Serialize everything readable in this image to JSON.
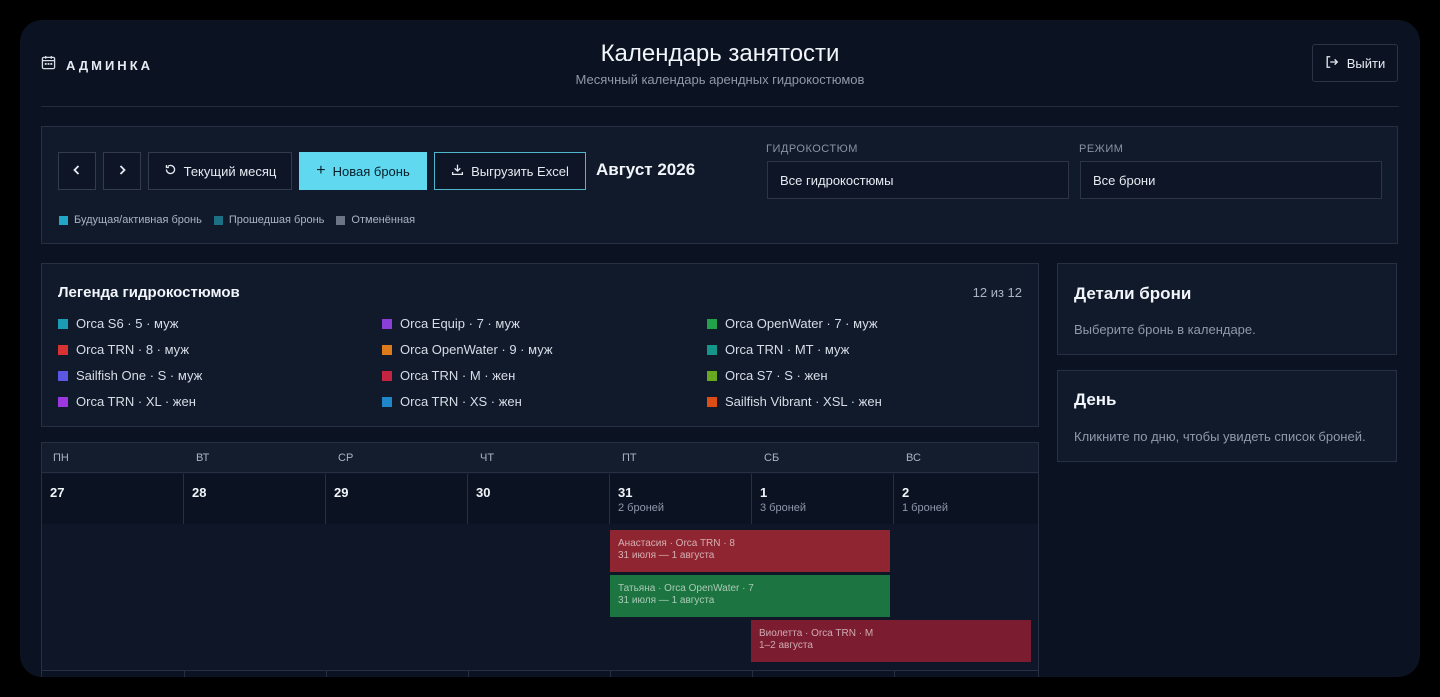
{
  "brand": {
    "label": "АДМИНКА",
    "icon": "calendar-icon"
  },
  "header": {
    "title": "Календарь занятости",
    "subtitle": "Месячный календарь арендных гидрокостюмов",
    "logout_label": "Выйти"
  },
  "toolbar": {
    "current_month_label": "Текущий месяц",
    "new_booking_label": "Новая бронь",
    "export_label": "Выгрузить Excel",
    "month_label": "Август 2026"
  },
  "filters": {
    "wetsuit_label": "ГИДРОКОСТЮМ",
    "wetsuit_value": "Все гидрокостюмы",
    "mode_label": "РЕЖИМ",
    "mode_value": "Все брони"
  },
  "status_legend": [
    {
      "label": "Будущая/активная бронь",
      "color": "#22a6c8"
    },
    {
      "label": "Прошедшая бронь",
      "color": "#1d6f86"
    },
    {
      "label": "Отменённая",
      "color": "#6b7585"
    }
  ],
  "wetsuit_legend": {
    "title": "Легенда гидрокостюмов",
    "count": "12 из 12",
    "items": [
      {
        "label": "Orca S6 · 5 · муж",
        "color": "#1c9bb5"
      },
      {
        "label": "Orca Equip · 7 · муж",
        "color": "#8b3fd6"
      },
      {
        "label": "Orca OpenWater · 7 · муж",
        "color": "#22a04a"
      },
      {
        "label": "Orca TRN · 8 · муж",
        "color": "#d83232"
      },
      {
        "label": "Orca OpenWater · 9 · муж",
        "color": "#dd7a1c"
      },
      {
        "label": "Orca TRN · MT · муж",
        "color": "#169688"
      },
      {
        "label": "Sailfish One · S · муж",
        "color": "#5b57e3"
      },
      {
        "label": "Orca TRN · M · жен",
        "color": "#c4243f"
      },
      {
        "label": "Orca S7 · S · жен",
        "color": "#68a820"
      },
      {
        "label": "Orca TRN · XL · жен",
        "color": "#9b38e0"
      },
      {
        "label": "Orca TRN · XS · жен",
        "color": "#1f86c9"
      },
      {
        "label": "Sailfish Vibrant · XSL · жен",
        "color": "#dd4e16"
      }
    ]
  },
  "details_panel": {
    "title": "Детали брони",
    "text": "Выберите бронь в календаре."
  },
  "day_panel": {
    "title": "День",
    "text": "Кликните по дню, чтобы увидеть список броней."
  },
  "calendar": {
    "weekdays": [
      "ПН",
      "ВТ",
      "СР",
      "ЧТ",
      "ПТ",
      "СБ",
      "ВС"
    ],
    "days": [
      {
        "num": "27",
        "count": ""
      },
      {
        "num": "28",
        "count": ""
      },
      {
        "num": "29",
        "count": ""
      },
      {
        "num": "30",
        "count": ""
      },
      {
        "num": "31",
        "count": "2 броней"
      },
      {
        "num": "1",
        "count": "3 броней"
      },
      {
        "num": "2",
        "count": "1 броней"
      }
    ],
    "events": [
      {
        "title": "Анастасия · Orca TRN · 8",
        "dates": "31 июля — 1 августа",
        "color": "#8f2530"
      },
      {
        "title": "Татьяна · Orca OpenWater · 7",
        "dates": "31 июля — 1 августа",
        "color": "#1c7440"
      },
      {
        "title": "Виолетта · Orca TRN · M",
        "dates": "1–2 августа",
        "color": "#7c1c30"
      }
    ]
  }
}
